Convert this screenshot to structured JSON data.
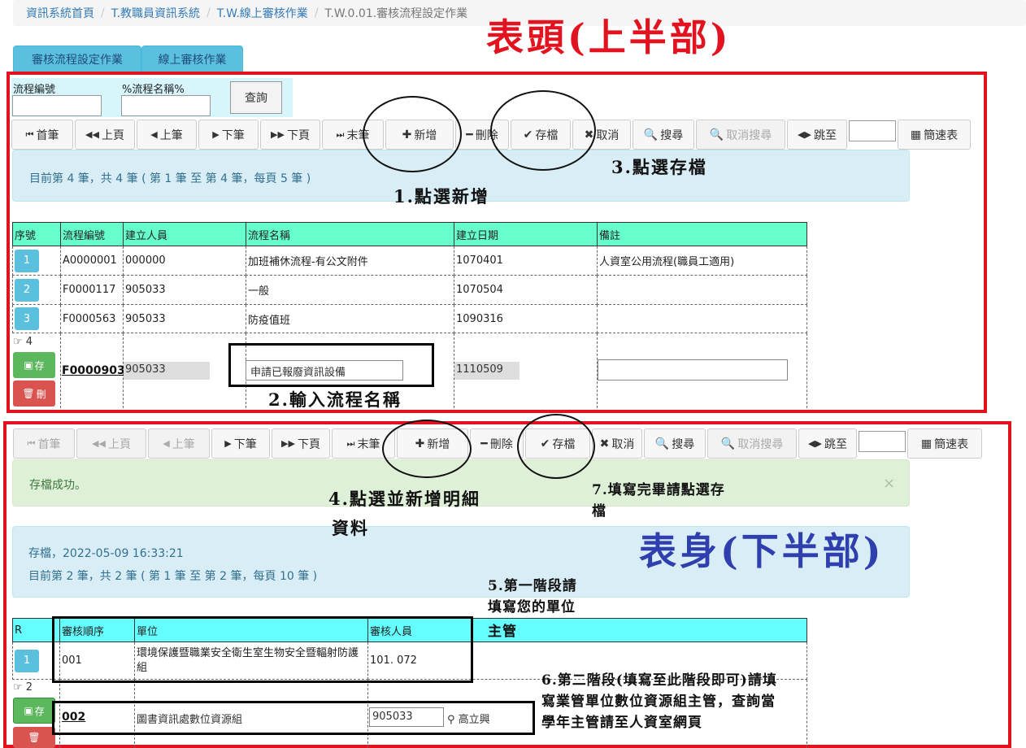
{
  "breadcrumb": [
    "資訊系統首頁",
    "T.教職員資訊系統",
    "T.W.線上審核作業",
    "T.W.0.01.審核流程設定作業"
  ],
  "tabs": [
    "審核流程設定作業",
    "線上審核作業"
  ],
  "query": {
    "label1": "流程編號",
    "label2": "%流程名稱%",
    "button": "查詢"
  },
  "toolbar": [
    "首筆",
    "上頁",
    "上筆",
    "下筆",
    "下頁",
    "末筆",
    "新增",
    "刪除",
    "存檔",
    "取消",
    "搜尋",
    "取消搜尋",
    "跳至",
    "簡速表"
  ],
  "header_alert": "目前第 4 筆，共 4 筆 ( 第 1 筆 至 第 4 筆，每頁 5 筆 )",
  "master_table": {
    "columns": [
      "序號",
      "流程編號",
      "建立人員",
      "流程名稱",
      "建立日期",
      "備註"
    ],
    "rows": [
      {
        "no": "1",
        "id": "A0000001",
        "creator": "000000",
        "name": "加班補休流程-有公文附件",
        "date": "1070401",
        "note": "人資室公用流程(職員工適用)"
      },
      {
        "no": "2",
        "id": "F0000117",
        "creator": "905033",
        "name": "一般",
        "date": "1070504",
        "note": ""
      },
      {
        "no": "3",
        "id": "F0000563",
        "creator": "905033",
        "name": "防疫值班",
        "date": "1090316",
        "note": ""
      }
    ],
    "edit_row": {
      "no": "4",
      "id": "F0000903",
      "creator": "905033",
      "name": "申請已報廢資訊設備",
      "date": "1110509",
      "save": "存",
      "del": "刪"
    }
  },
  "detail_alert_success": "存檔成功。",
  "detail_alert_close": "×",
  "detail_alert": {
    "line1": "存檔，2022-05-09 16:33:21",
    "line2": "目前第 2 筆，共 2 筆 ( 第 1 筆 至 第 2 筆，每頁 10 筆 )"
  },
  "detail_table": {
    "columns": [
      "R",
      "審核順序",
      "單位",
      "審核人員"
    ],
    "row1": {
      "no": "1",
      "seq": "001",
      "unit": "環境保護暨職業安全衛生室生物安全暨輻射防護組",
      "person": "101. 072"
    },
    "edit_row": {
      "no": "2",
      "seq": "002",
      "unit": "圖書資訊處數位資源組",
      "person": "905033",
      "person_name": "高立興",
      "save": "存"
    }
  },
  "annotations": {
    "header_title": "表頭(上半部)",
    "body_title": "表身(下半部)",
    "step1": "1.點選新增",
    "step2": "2.輸入流程名稱",
    "step3": "3.點選存檔",
    "step4a": "4.點選並新增明細",
    "step4b": "資料",
    "step5a": "5.第一階段請",
    "step5b": "填寫您的單位",
    "step5c": "主管",
    "step6a": "6.第二階段(填寫至此階段即可)請填",
    "step6b": "寫業管單位數位資源組主管，查詢當",
    "step6c": "學年主管請至人資室網頁",
    "step7a": "7.填寫完畢請點選存",
    "step7b": "檔"
  },
  "colors": {
    "red_box": "#e2121e",
    "header_title": "#e2121e",
    "body_title": "#2f3fae",
    "table_head": "#66ffcc"
  }
}
